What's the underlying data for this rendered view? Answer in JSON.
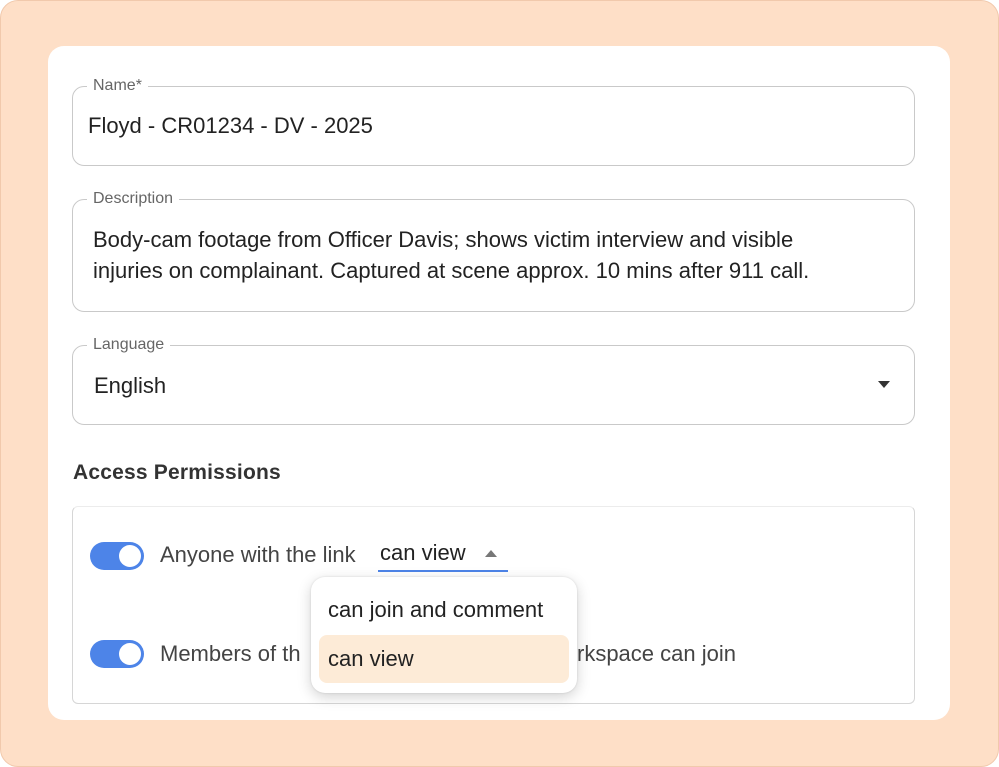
{
  "form": {
    "name": {
      "label": "Name",
      "required_mark": "*",
      "value": "Floyd - CR01234 - DV - 2025"
    },
    "description": {
      "label": "Description",
      "line1": "Body-cam footage from Officer Davis; shows victim interview and visible",
      "line2": "injuries on complainant. Captured at scene approx. 10 mins after 911 call."
    },
    "language": {
      "label": "Language",
      "value": "English"
    }
  },
  "permissions": {
    "title": "Access Permissions",
    "link_access": {
      "enabled": true,
      "text": "Anyone with the link",
      "selected": "can view"
    },
    "workspace_access": {
      "enabled": true,
      "text_start": "Members of th",
      "text_end": "rkspace can join"
    },
    "menu": {
      "options": [
        "can join and comment",
        "can view"
      ],
      "selected": "can view"
    }
  },
  "colors": {
    "background": "#fedfc7",
    "accent": "#4d84e8",
    "menu_highlight": "#fdebd7"
  }
}
